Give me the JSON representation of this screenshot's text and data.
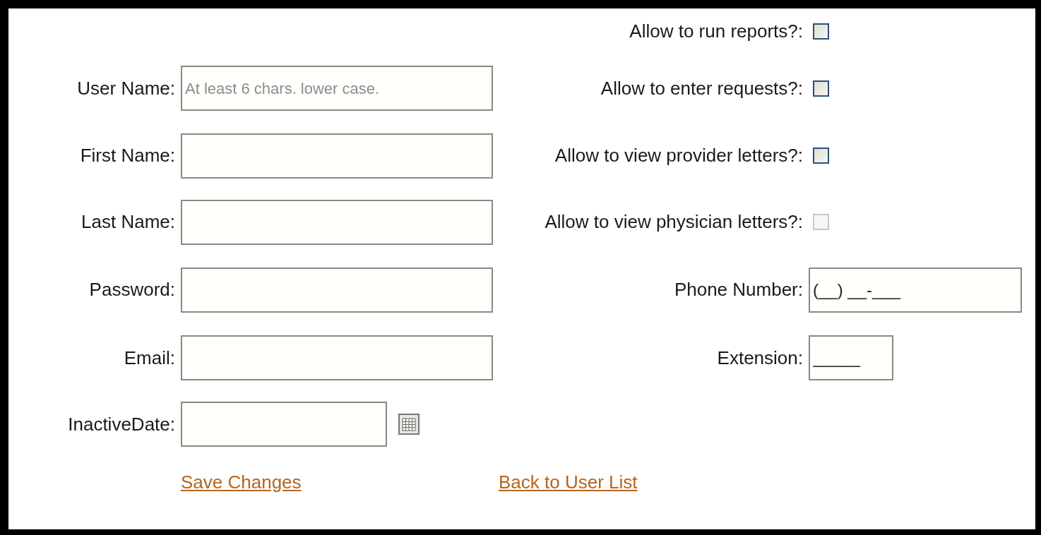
{
  "left_fields": [
    {
      "label": "User Name:",
      "kind": "text",
      "placeholder": "At least 6 chars. lower case."
    },
    {
      "label": "First Name:",
      "kind": "text"
    },
    {
      "label": "Last Name:",
      "kind": "text"
    },
    {
      "label": "Password:",
      "kind": "text"
    },
    {
      "label": "Email:",
      "kind": "text"
    },
    {
      "label": "InactiveDate:",
      "kind": "date"
    }
  ],
  "permissions": [
    {
      "label": "Allow to run reports?:",
      "checked": false,
      "disabled": false
    },
    {
      "label": "Allow to enter requests?:",
      "checked": false,
      "disabled": false
    },
    {
      "label": "Allow to view provider letters?:",
      "checked": false,
      "disabled": false
    },
    {
      "label": "Allow to view physician letters?:",
      "checked": false,
      "disabled": true
    }
  ],
  "right_fields": [
    {
      "label": "Phone Number:",
      "value": "(__) __-___",
      "kind": "phone"
    },
    {
      "label": "Extension:",
      "value": "_____",
      "kind": "short"
    }
  ],
  "links": [
    "Save Changes",
    "Back to User List"
  ]
}
